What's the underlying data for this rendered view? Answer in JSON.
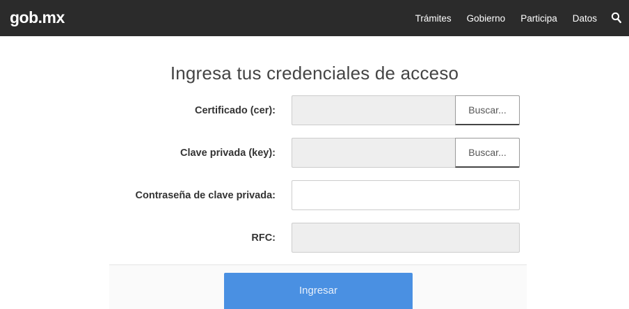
{
  "header": {
    "brand": "gob.mx",
    "nav": [
      "Trámites",
      "Gobierno",
      "Participa",
      "Datos"
    ],
    "search_icon": "search-icon"
  },
  "form": {
    "title": "Ingresa tus credenciales de acceso",
    "certificado_label": "Certificado (cer):",
    "certificado_button": "Buscar...",
    "clave_label": "Clave privada (key):",
    "clave_button": "Buscar...",
    "password_label": "Contraseña de clave privada:",
    "rfc_label": "RFC:",
    "submit_label": "Ingresar"
  },
  "colors": {
    "navbar": "#2b2b2b",
    "submit": "#4a90e2"
  }
}
